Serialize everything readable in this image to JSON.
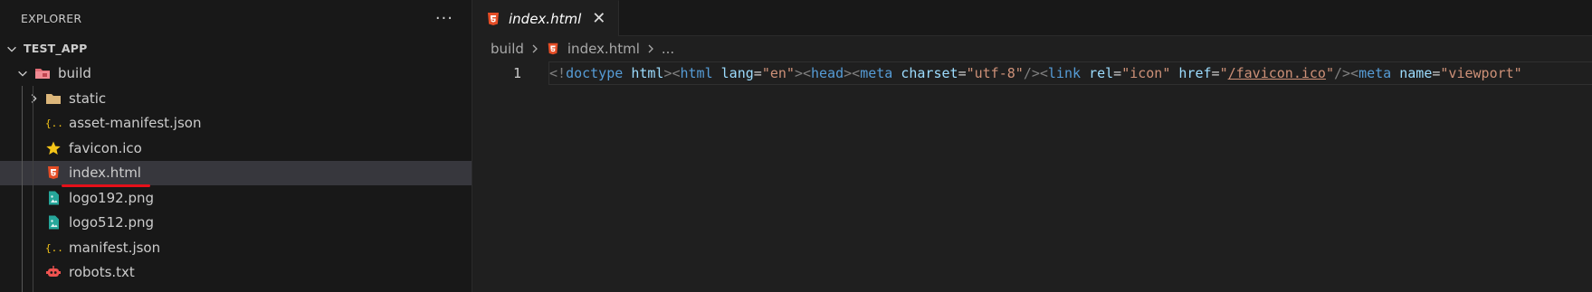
{
  "sidebar": {
    "title": "EXPLORER",
    "more_glyph": "···",
    "project": "TEST_APP",
    "folder_build": "build",
    "items": [
      {
        "label": "static",
        "icon": "folder-icon"
      },
      {
        "label": "asset-manifest.json",
        "icon": "json-icon"
      },
      {
        "label": "favicon.ico",
        "icon": "star-icon"
      },
      {
        "label": "index.html",
        "icon": "html5-icon",
        "selected": true
      },
      {
        "label": "logo192.png",
        "icon": "image-icon"
      },
      {
        "label": "logo512.png",
        "icon": "image-icon"
      },
      {
        "label": "manifest.json",
        "icon": "json-icon"
      },
      {
        "label": "robots.txt",
        "icon": "robot-icon"
      }
    ]
  },
  "editor": {
    "tab_label": "index.html",
    "tab_close": "✕",
    "breadcrumb": [
      "build",
      "index.html",
      "..."
    ],
    "line_number": "1",
    "code_tokens": [
      {
        "t": "<!",
        "c": "t-punc"
      },
      {
        "t": "doctype",
        "c": "t-tag"
      },
      {
        "t": " ",
        "c": ""
      },
      {
        "t": "html",
        "c": "t-attr"
      },
      {
        "t": "><",
        "c": "t-punc"
      },
      {
        "t": "html",
        "c": "t-tag"
      },
      {
        "t": " ",
        "c": ""
      },
      {
        "t": "lang",
        "c": "t-attr"
      },
      {
        "t": "=",
        "c": ""
      },
      {
        "t": "\"en\"",
        "c": "t-str"
      },
      {
        "t": "><",
        "c": "t-punc"
      },
      {
        "t": "head",
        "c": "t-tag"
      },
      {
        "t": "><",
        "c": "t-punc"
      },
      {
        "t": "meta",
        "c": "t-tag"
      },
      {
        "t": " ",
        "c": ""
      },
      {
        "t": "charset",
        "c": "t-attr"
      },
      {
        "t": "=",
        "c": ""
      },
      {
        "t": "\"utf-8\"",
        "c": "t-str"
      },
      {
        "t": "/><",
        "c": "t-punc"
      },
      {
        "t": "link",
        "c": "t-tag"
      },
      {
        "t": " ",
        "c": ""
      },
      {
        "t": "rel",
        "c": "t-attr"
      },
      {
        "t": "=",
        "c": ""
      },
      {
        "t": "\"icon\"",
        "c": "t-str"
      },
      {
        "t": " ",
        "c": ""
      },
      {
        "t": "href",
        "c": "t-attr"
      },
      {
        "t": "=",
        "c": ""
      },
      {
        "t": "\"",
        "c": "t-str"
      },
      {
        "t": "/favicon.ico",
        "c": "t-str t-link"
      },
      {
        "t": "\"",
        "c": "t-str"
      },
      {
        "t": "/><",
        "c": "t-punc"
      },
      {
        "t": "meta",
        "c": "t-tag"
      },
      {
        "t": " ",
        "c": ""
      },
      {
        "t": "name",
        "c": "t-attr"
      },
      {
        "t": "=",
        "c": ""
      },
      {
        "t": "\"viewport\"",
        "c": "t-str"
      }
    ]
  },
  "colors": {
    "accent_html": "#e44d26",
    "folder_yellow": "#dcb67a",
    "build_folder_red": "#e06c75",
    "json_yellow": "#f5c518",
    "image_teal": "#26a69a",
    "robot_red": "#ef5350",
    "annotation_red": "#e5101a"
  }
}
